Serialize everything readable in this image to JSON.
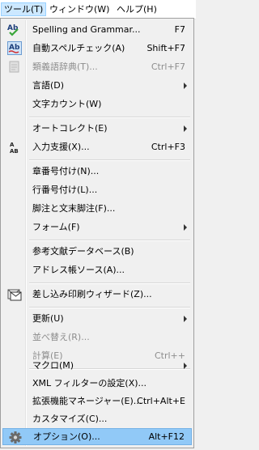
{
  "menubar": {
    "tools": "ツール(T)",
    "window": "ウィンドウ(W)",
    "help": "ヘルプ(H)"
  },
  "menu": {
    "items": [
      {
        "label": "Spelling and Grammar...",
        "shortcut": "F7",
        "icon": "spelling-check-icon"
      },
      {
        "label": "自動スペルチェック(A)",
        "shortcut": "Shift+F7",
        "icon": "auto-spellcheck-icon"
      },
      {
        "label": "類義語辞典(T)...",
        "shortcut": "Ctrl+F7",
        "icon": "thesaurus-icon",
        "disabled": true
      },
      {
        "label": "言語(D)",
        "submenu": true
      },
      {
        "label": "文字カウント(W)"
      },
      {
        "label": "オートコレクト(E)",
        "submenu": true
      },
      {
        "label": "入力支援(X)...",
        "shortcut": "Ctrl+F3",
        "icon": "word-completion-icon"
      },
      {
        "label": "章番号付け(N)..."
      },
      {
        "label": "行番号付け(L)..."
      },
      {
        "label": "脚注と文末脚注(F)..."
      },
      {
        "label": "フォーム(F)",
        "submenu": true
      },
      {
        "label": "参考文献データベース(B)"
      },
      {
        "label": "アドレス帳ソース(A)..."
      },
      {
        "label": "差し込み印刷ウィザード(Z)...",
        "icon": "mail-merge-icon"
      },
      {
        "label": "更新(U)",
        "submenu": true
      },
      {
        "label": "並べ替え(R)...",
        "disabled": true
      },
      {
        "label": "計算(E)",
        "shortcut": "Ctrl++",
        "disabled": true
      },
      {
        "label": "マクロ(M)",
        "submenu": true
      },
      {
        "label": "XML フィルターの設定(X)..."
      },
      {
        "label": "拡張機能マネージャー(E)...",
        "shortcut": "Ctrl+Alt+E"
      },
      {
        "label": "カスタマイズ(C)..."
      },
      {
        "label": "オプション(O)...",
        "shortcut": "Alt+F12",
        "icon": "options-gear-icon",
        "highlighted": true
      }
    ]
  }
}
